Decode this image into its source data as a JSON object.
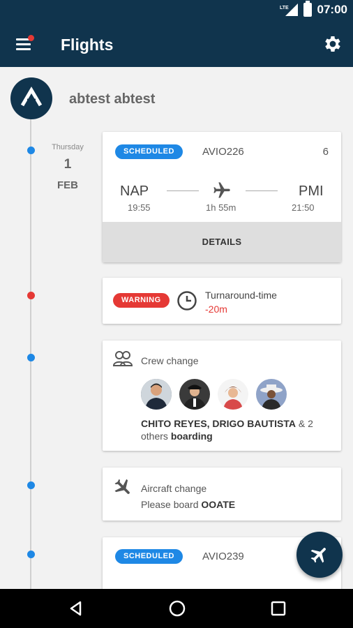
{
  "status_bar": {
    "time": "07:00",
    "network": "LTE"
  },
  "app_bar": {
    "title": "Flights"
  },
  "user": {
    "name": "abtest abtest",
    "logo_letter": "A"
  },
  "date": {
    "weekday": "Thursday",
    "day": "1",
    "month": "FEB"
  },
  "flight_card_1": {
    "status": "SCHEDULED",
    "flight_code": "AVIO226",
    "count": "6",
    "from_airport": "NAP",
    "from_time": "19:55",
    "duration": "1h 55m",
    "to_airport": "PMI",
    "to_time": "21:50",
    "details_label": "DETAILS"
  },
  "warning_card": {
    "status": "WARNING",
    "title": "Turnaround-time",
    "value": "-20m"
  },
  "crew_card": {
    "title": "Crew change",
    "names": "CHITO REYES, DRIGO BAUTISTA",
    "amp": " & 2 others ",
    "action": "boarding"
  },
  "aircraft_card": {
    "title": "Aircraft change",
    "prefix": "Please board ",
    "aircraft": "OOATE"
  },
  "flight_card_2": {
    "status": "SCHEDULED",
    "flight_code": "AVIO239"
  },
  "colors": {
    "primary": "#10344d",
    "accent_blue": "#1e88e5",
    "warning_red": "#e53935"
  }
}
